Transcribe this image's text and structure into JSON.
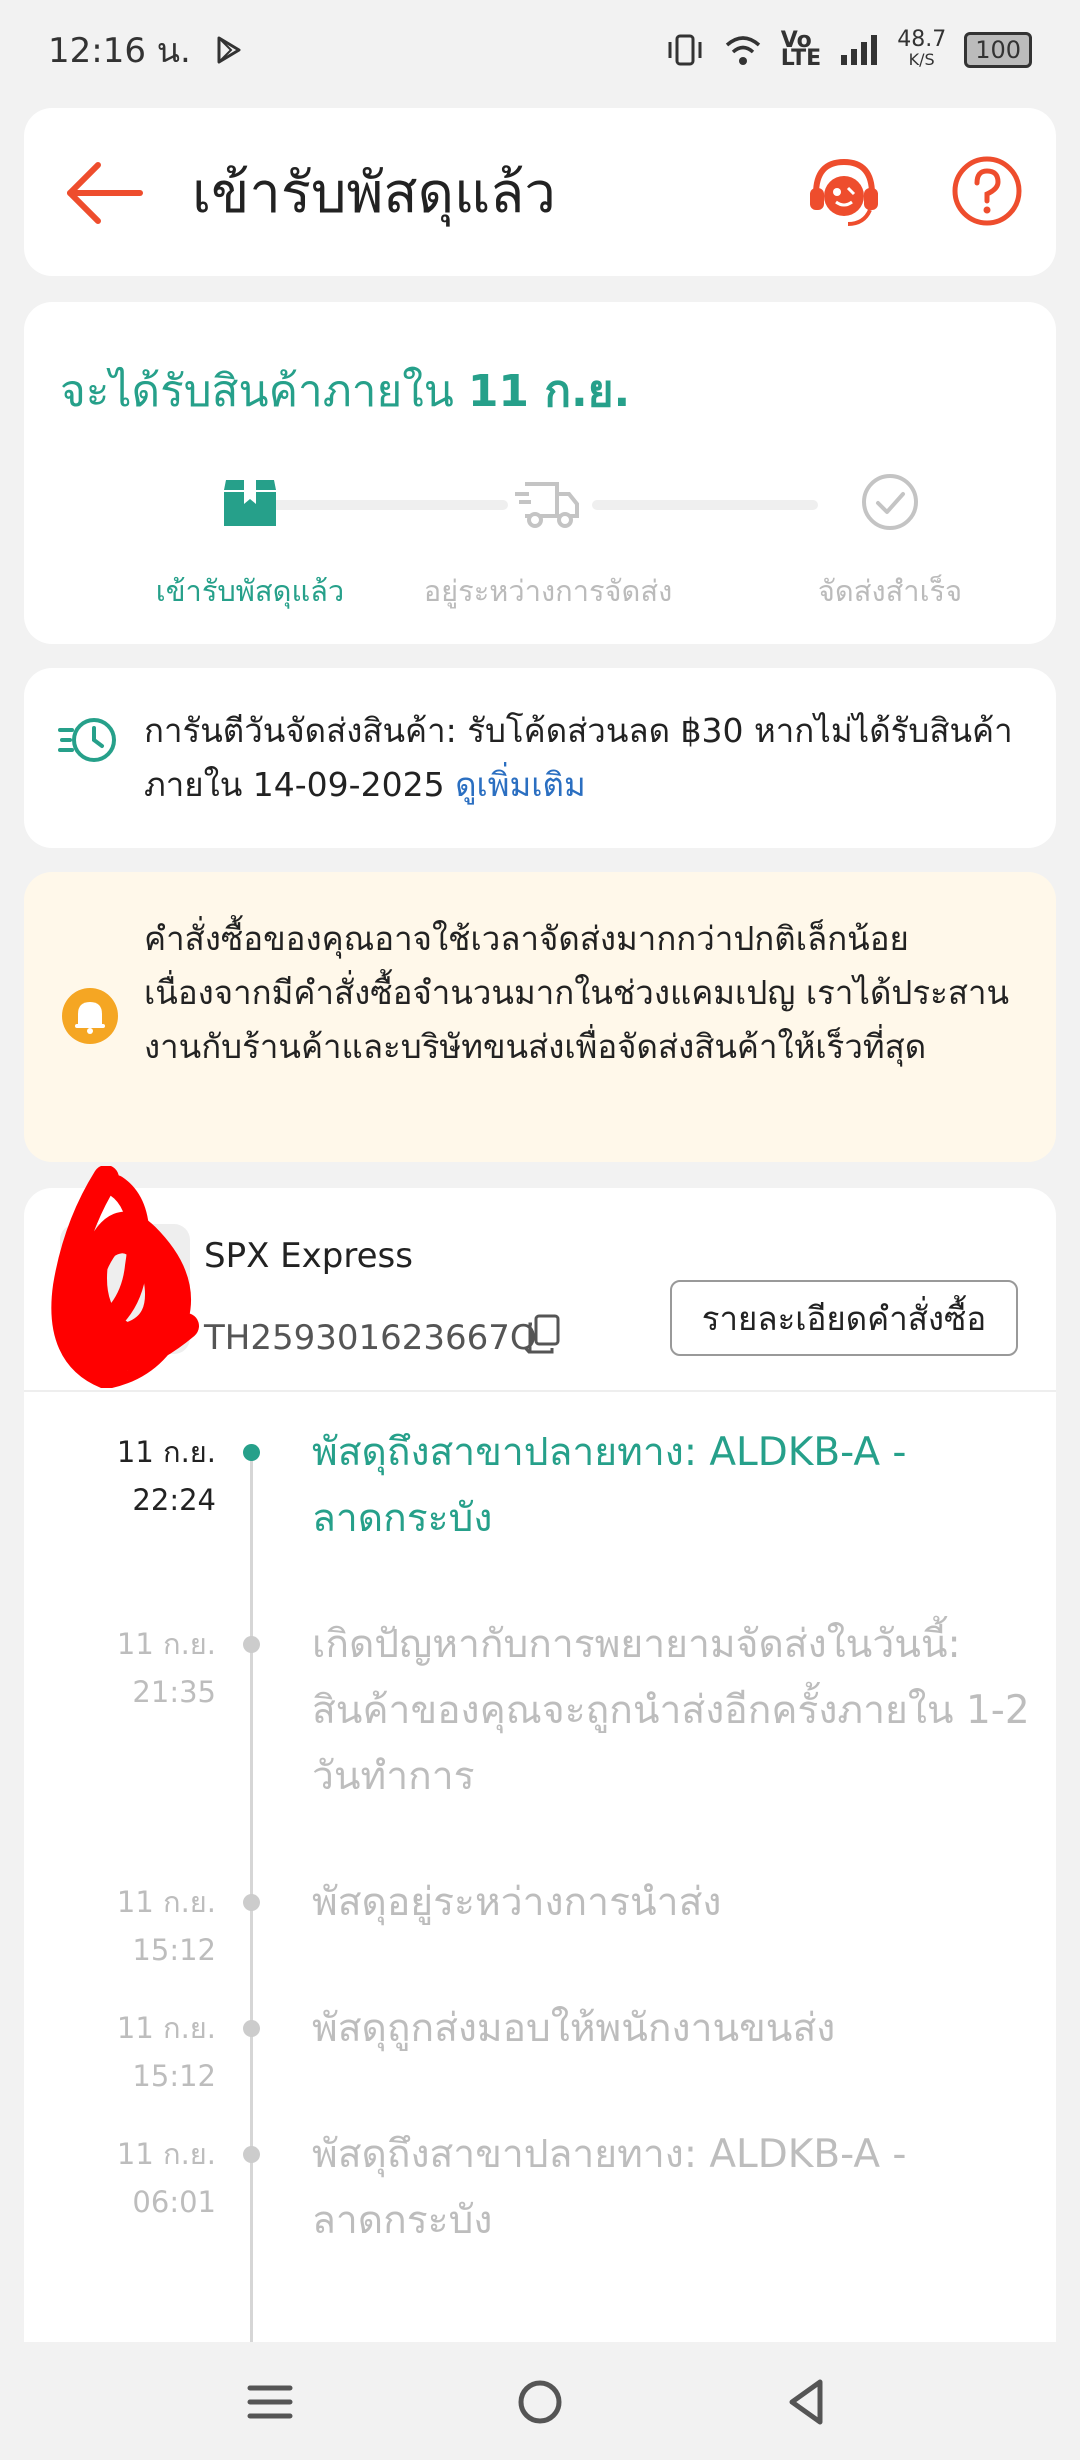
{
  "status_bar": {
    "time": "12:16 น.",
    "network_speed": "48.7",
    "network_unit": "K/S",
    "volte": "Vo",
    "lte": "LTE",
    "battery": "100"
  },
  "header": {
    "title": "เข้ารับพัสดุแล้ว"
  },
  "eta": {
    "prefix": "จะได้รับสินค้าภายใน",
    "date": "11 ก.ย.",
    "steps": [
      {
        "label": "เข้ารับพัสดุแล้ว",
        "icon": "package-icon",
        "active": true
      },
      {
        "label": "อยู่ระหว่างการจัดส่ง",
        "icon": "truck-icon",
        "active": false
      },
      {
        "label": "จัดส่งสำเร็จ",
        "icon": "check-circle-icon",
        "active": false
      }
    ]
  },
  "guarantee": {
    "text": "การันตีวันจัดส่งสินค้า: รับโค้ดส่วนลด ฿30 หากไม่ได้รับสินค้าภายใน 14-09-2025",
    "link": "ดูเพิ่มเติม"
  },
  "notice": {
    "text": "คำสั่งซื้อของคุณอาจใช้เวลาจัดส่งมากกว่าปกติเล็กน้อย เนื่องจากมีคำสั่งซื้อจำนวนมากในช่วงแคมเปญ เราได้ประสานงานกับร้านค้าและบริษัทขนส่งเพื่อจัดส่งสินค้าให้เร็วที่สุด"
  },
  "shipment": {
    "carrier": "SPX Express",
    "tracking_number": "TH259301623667Q",
    "order_details_label": "รายละเอียดคำสั่งซื้อ"
  },
  "events": [
    {
      "date": "11 ก.ย.",
      "time": "22:24",
      "desc": "พัสดุถึงสาขาปลายทาง: ALDKB-A - ลาดกระบัง"
    },
    {
      "date": "11 ก.ย.",
      "time": "21:35",
      "desc": "เกิดปัญหากับการพยายามจัดส่งในวันนี้: สินค้าของคุณจะถูกนำส่งอีกครั้งภายใน 1-2 วันทำการ"
    },
    {
      "date": "11 ก.ย.",
      "time": "15:12",
      "desc": "พัสดุอยู่ระหว่างการนำส่ง"
    },
    {
      "date": "11 ก.ย.",
      "time": "15:12",
      "desc": "พัสดุถูกส่งมอบให้พนักงานขนส่ง"
    },
    {
      "date": "11 ก.ย.",
      "time": "06:01",
      "desc": "พัสดุถึงสาขาปลายทาง: ALDKB-A - ลาดกระบัง"
    }
  ],
  "colors": {
    "accent": "#26A08A",
    "brand": "#EE4D2D",
    "link": "#2B6FC1",
    "notice_bg": "#FFF8EA",
    "bell": "#F5A623"
  }
}
